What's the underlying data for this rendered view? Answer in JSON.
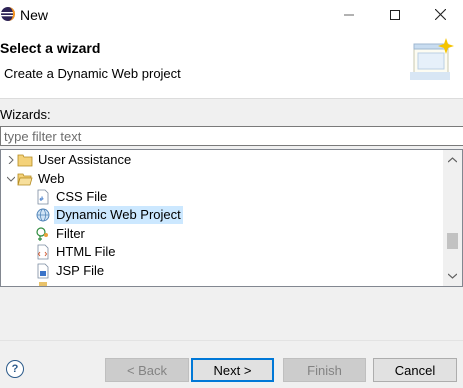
{
  "window": {
    "title": "New",
    "icons": {
      "app": "eclipse-icon",
      "minimize": "minimize-icon",
      "maximize": "maximize-icon",
      "close": "close-icon"
    }
  },
  "banner": {
    "title": "Select a wizard",
    "subtitle": "Create a Dynamic Web project",
    "image": "new-wizard-icon"
  },
  "filter": {
    "label": "Wizards:",
    "placeholder": "type filter text",
    "value": ""
  },
  "tree": {
    "items": [
      {
        "label": "User Assistance",
        "icon": "folder-icon",
        "expanded": false,
        "level": 0
      },
      {
        "label": "Web",
        "icon": "folder-open-icon",
        "expanded": true,
        "level": 0
      },
      {
        "label": "CSS File",
        "icon": "css-file-icon",
        "level": 1
      },
      {
        "label": "Dynamic Web Project",
        "icon": "web-project-icon",
        "level": 1,
        "selected": true
      },
      {
        "label": "Filter",
        "icon": "filter-icon",
        "level": 1
      },
      {
        "label": "HTML File",
        "icon": "html-file-icon",
        "level": 1
      },
      {
        "label": "JSP File",
        "icon": "jsp-file-icon",
        "level": 1
      }
    ]
  },
  "buttons": {
    "help": "?",
    "back": "< Back",
    "next": "Next >",
    "finish": "Finish",
    "cancel": "Cancel"
  },
  "colors": {
    "selection": "#cce8ff",
    "accent": "#0078d7"
  }
}
